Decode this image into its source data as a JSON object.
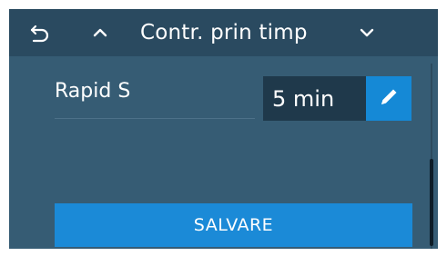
{
  "header": {
    "back_icon": "undo-arrow-icon",
    "up_icon": "chevron-up-icon",
    "title": "Contr. prin timp",
    "down_icon": "chevron-down-icon"
  },
  "setting": {
    "label": "Rapid S",
    "value": "5 min",
    "edit_icon": "pencil-icon"
  },
  "actions": {
    "save_label": "SALVARE"
  },
  "colors": {
    "background": "#365c74",
    "header": "#2a4a60",
    "value_box": "#1f394b",
    "accent": "#1b8ad7"
  }
}
